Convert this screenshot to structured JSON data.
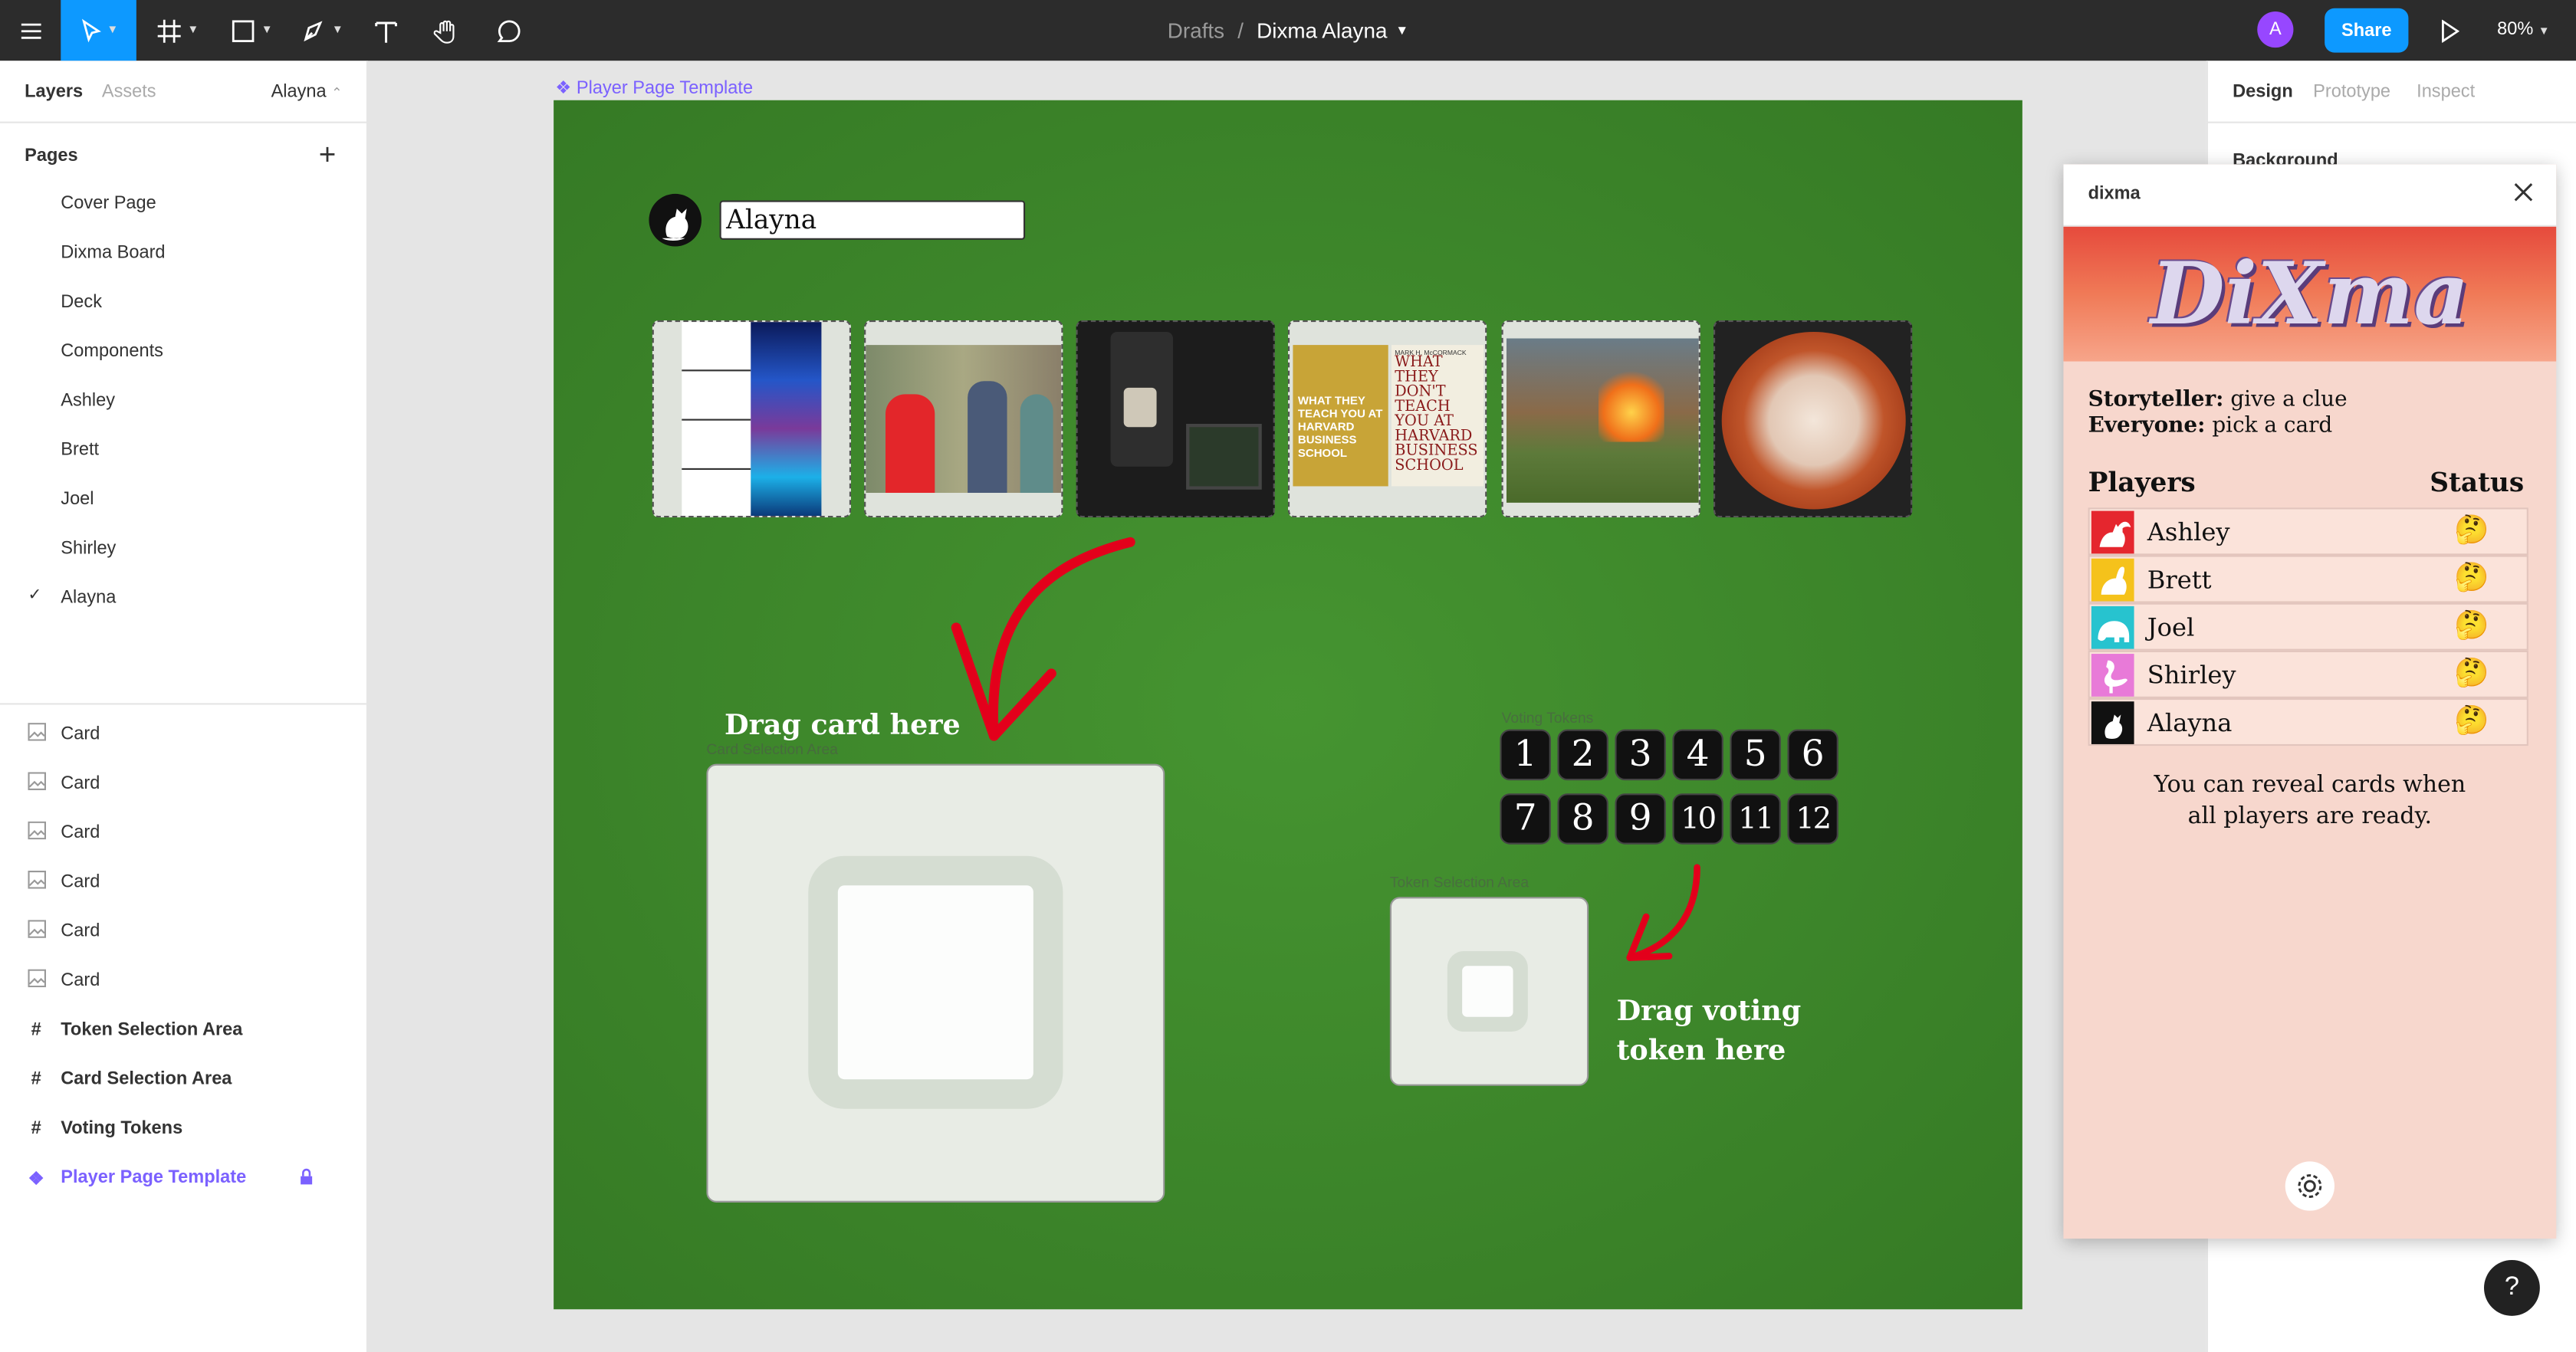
{
  "topbar": {
    "breadcrumb_parent": "Drafts",
    "breadcrumb_sep": "/",
    "file_name": "Dixma Alayna",
    "avatar_letter": "A",
    "share_label": "Share",
    "zoom": "80%",
    "accent": "#0d99ff"
  },
  "left_panel": {
    "tab_layers": "Layers",
    "tab_assets": "Assets",
    "current_page": "Alayna",
    "pages_heading": "Pages",
    "pages": [
      "Cover Page",
      "Dixma Board",
      "Deck",
      "Components",
      "Ashley",
      "Brett",
      "Joel",
      "Shirley",
      "Alayna"
    ],
    "selected_page": "Alayna",
    "check": "✓",
    "layers": [
      {
        "label": "Card",
        "icon": "image-icon"
      },
      {
        "label": "Card",
        "icon": "image-icon"
      },
      {
        "label": "Card",
        "icon": "image-icon"
      },
      {
        "label": "Card",
        "icon": "image-icon"
      },
      {
        "label": "Card",
        "icon": "image-icon"
      },
      {
        "label": "Card",
        "icon": "image-icon"
      },
      {
        "label": "Token Selection Area",
        "icon": "frame-icon"
      },
      {
        "label": "Card Selection Area",
        "icon": "frame-icon"
      },
      {
        "label": "Voting Tokens",
        "icon": "frame-icon"
      },
      {
        "label": "Player Page Template",
        "icon": "component-icon"
      }
    ]
  },
  "canvas": {
    "frame_label": "Player Page Template",
    "player_name": "Alayna",
    "drag_card": "Drag card here",
    "card_area_label": "Card Selection Area",
    "voting_label": "Voting Tokens",
    "token_area_label": "Token Selection Area",
    "drag_token_line1": "Drag voting",
    "drag_token_line2": "token here",
    "tokens_row1": [
      "1",
      "2",
      "3",
      "4",
      "5",
      "6"
    ],
    "tokens_row2": [
      "7",
      "8",
      "9",
      "10",
      "11",
      "12"
    ],
    "card_book_left": "WHAT THEY TEACH YOU AT HARVARD BUSINESS SCHOOL",
    "card_book_right_author": "MARK H. McCORMACK",
    "card_book_right": "WHAT THEY DON'T TEACH YOU AT HARVARD BUSINESS SCHOOL",
    "board_color": "#3f8c2c"
  },
  "right_panel": {
    "tab_design": "Design",
    "tab_prototype": "Prototype",
    "tab_inspect": "Inspect",
    "background_label": "Background"
  },
  "plugin": {
    "title": "dixma",
    "logo": "DiXma",
    "storyteller_label": "Storyteller:",
    "storyteller_text": "give a clue",
    "everyone_label": "Everyone:",
    "everyone_text": "pick a card",
    "players_heading": "Players",
    "status_heading": "Status",
    "players": [
      {
        "name": "Ashley",
        "color": "#e5262e",
        "status": "🤔"
      },
      {
        "name": "Brett",
        "color": "#f5c21b",
        "status": "🤔"
      },
      {
        "name": "Joel",
        "color": "#27c3cf",
        "status": "🤔"
      },
      {
        "name": "Shirley",
        "color": "#e87ad8",
        "status": "🤔"
      },
      {
        "name": "Alayna",
        "color": "#111111",
        "status": "🤔"
      }
    ],
    "reveal_line1": "You can reveal cards when",
    "reveal_line2": "all players are ready."
  },
  "help_label": "?"
}
